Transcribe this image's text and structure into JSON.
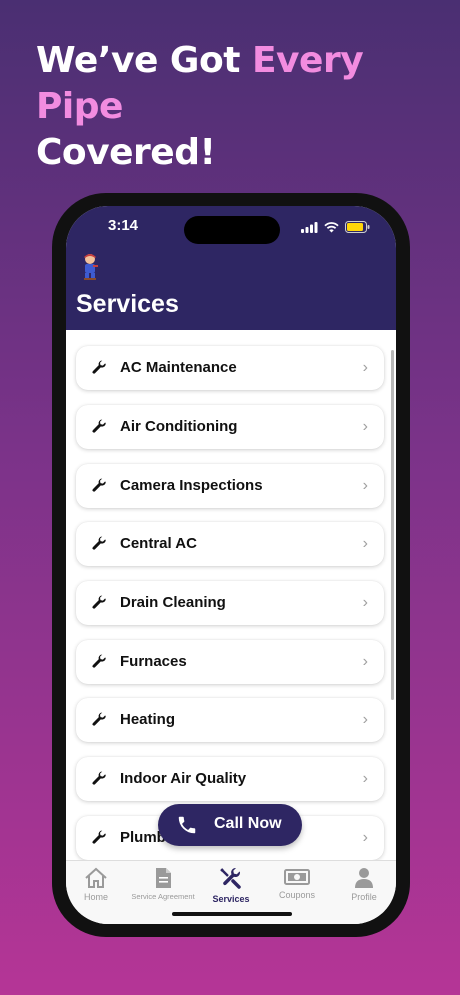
{
  "headline": {
    "line_pre": "We’ve Got ",
    "accent": "Every Pipe",
    "line_post": "Covered!"
  },
  "status_bar": {
    "time": "3:14"
  },
  "header": {
    "title": "Services"
  },
  "services": [
    {
      "label": "AC Maintenance"
    },
    {
      "label": "Air Conditioning"
    },
    {
      "label": "Camera Inspections"
    },
    {
      "label": "Central AC"
    },
    {
      "label": "Drain Cleaning"
    },
    {
      "label": "Furnaces"
    },
    {
      "label": "Heating"
    },
    {
      "label": "Indoor Air Quality"
    },
    {
      "label": "Plumbi"
    }
  ],
  "call_button": {
    "label": "Call Now"
  },
  "tabs": [
    {
      "label": "Home",
      "icon": "home-icon"
    },
    {
      "label": "Service Agreement",
      "icon": "document-icon"
    },
    {
      "label": "Services",
      "icon": "tools-icon",
      "active": true
    },
    {
      "label": "Coupons",
      "icon": "money-icon"
    },
    {
      "label": "Profile",
      "icon": "person-icon"
    }
  ],
  "colors": {
    "brand_navy": "#2e2663",
    "accent_pink": "#f28ce0",
    "background_top": "#4a2f72",
    "background_bottom": "#b53596"
  }
}
